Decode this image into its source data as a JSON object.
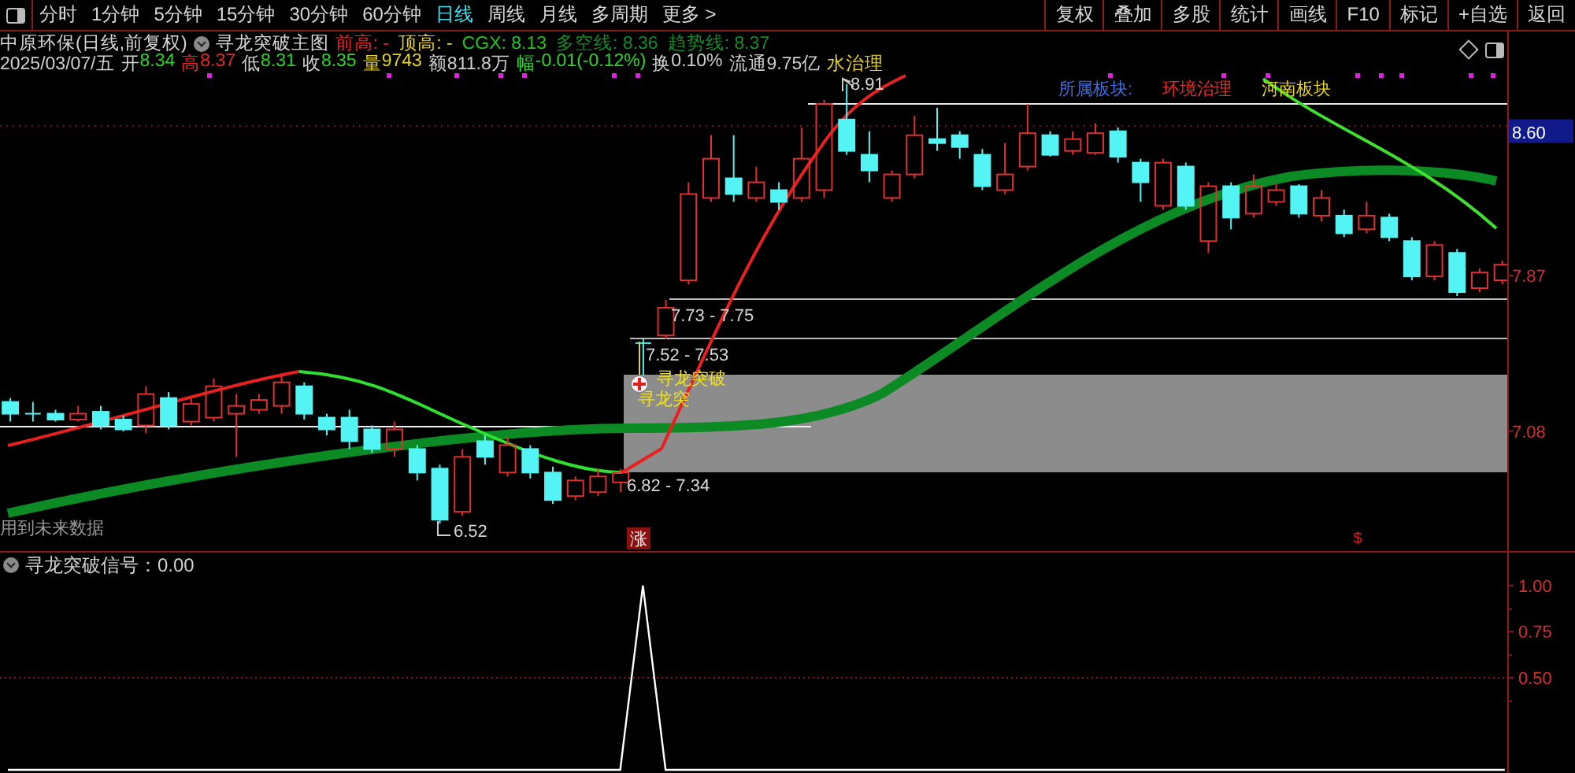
{
  "toolbar": {
    "periods": [
      {
        "label": "分时",
        "selected": false
      },
      {
        "label": "1分钟",
        "selected": false
      },
      {
        "label": "5分钟",
        "selected": false
      },
      {
        "label": "15分钟",
        "selected": false
      },
      {
        "label": "30分钟",
        "selected": false
      },
      {
        "label": "60分钟",
        "selected": false
      },
      {
        "label": "日线",
        "selected": true
      },
      {
        "label": "周线",
        "selected": false
      },
      {
        "label": "月线",
        "selected": false
      },
      {
        "label": "多周期",
        "selected": false
      },
      {
        "label": "更多 >",
        "selected": false
      }
    ],
    "buttons": [
      "复权",
      "叠加",
      "多股",
      "统计",
      "画线",
      "F10",
      "标记",
      "+自选",
      "返回"
    ]
  },
  "header": {
    "stock": "中原环保(日线,前复权)",
    "indicator": "寻龙突破主图",
    "fields": [
      {
        "text": "前高: -",
        "color": "#e8262a"
      },
      {
        "text": "顶高: -",
        "color": "#e6d220"
      },
      {
        "text": "CGX: 8.13",
        "color": "#22c322"
      },
      {
        "text": "多空线: 8.36",
        "color": "#138a2c"
      },
      {
        "text": "趋势线: 8.37",
        "color": "#138a2c"
      }
    ]
  },
  "quote": {
    "date": "2025/03/07/五",
    "fields": [
      {
        "parts": [
          {
            "text": "开",
            "color": "#d0d0d0"
          },
          {
            "text": "8.34",
            "color": "#2ed12e"
          }
        ]
      },
      {
        "parts": [
          {
            "text": "高",
            "color": "#e8262a"
          },
          {
            "text": "8.37",
            "color": "#e8262a"
          }
        ]
      },
      {
        "parts": [
          {
            "text": "低",
            "color": "#d0d0d0"
          },
          {
            "text": "8.31",
            "color": "#2ed12e"
          }
        ]
      },
      {
        "parts": [
          {
            "text": "收",
            "color": "#d0d0d0"
          },
          {
            "text": "8.35",
            "color": "#2ed12e"
          }
        ]
      },
      {
        "parts": [
          {
            "text": "量",
            "color": "#e6d220"
          },
          {
            "text": "9743",
            "color": "#e6d220"
          }
        ]
      },
      {
        "parts": [
          {
            "text": "额",
            "color": "#d0d0d0"
          },
          {
            "text": "811.8万",
            "color": "#d0d0d0"
          }
        ]
      },
      {
        "parts": [
          {
            "text": "幅",
            "color": "#2ed12e"
          },
          {
            "text": "-0.01(-0.12%)",
            "color": "#2ed12e"
          }
        ]
      },
      {
        "parts": [
          {
            "text": "换",
            "color": "#d0d0d0"
          },
          {
            "text": "0.10%",
            "color": "#d0d0d0"
          }
        ]
      },
      {
        "parts": [
          {
            "text": "流通",
            "color": "#d0d0d0"
          },
          {
            "text": "9.75亿",
            "color": "#d0d0d0"
          }
        ]
      },
      {
        "parts": [
          {
            "text": "水治理",
            "color": "#e6d220"
          }
        ]
      }
    ]
  },
  "chart": {
    "sector_label": "所属板块:",
    "sector": "环境治理",
    "region": "河南板块",
    "annotations": [
      "8.91",
      "7.73 - 7.75",
      "7.52 - 7.53",
      "6.82 - 7.34",
      "6.52"
    ],
    "signal_labels": [
      "寻龙突破",
      "寻龙突"
    ],
    "note": "用到未来数据",
    "markers": [
      {
        "text": "涨",
        "kind": "badge"
      },
      {
        "text": "$",
        "kind": "plain"
      }
    ],
    "price_ticks": [
      {
        "highlighted": true
      },
      {
        "highlighted": false
      },
      {
        "highlighted": false
      }
    ],
    "chart_data": {
      "type": "candlestick",
      "ylim": [
        6.47,
        9.11
      ],
      "yticks": [
        {
          "value": 8.6,
          "label": "8.60"
        },
        {
          "value": 7.87,
          "label": "7.87"
        },
        {
          "value": 7.08,
          "label": "7.08"
        }
      ],
      "ohlc": [
        [
          7.23,
          7.25,
          7.13,
          7.17
        ],
        [
          7.17,
          7.23,
          7.13,
          7.17
        ],
        [
          7.17,
          7.19,
          7.13,
          7.14
        ],
        [
          7.14,
          7.21,
          7.13,
          7.17
        ],
        [
          7.18,
          7.21,
          7.09,
          7.11
        ],
        [
          7.14,
          7.16,
          7.08,
          7.09
        ],
        [
          7.11,
          7.31,
          7.07,
          7.27
        ],
        [
          7.25,
          7.28,
          7.09,
          7.11
        ],
        [
          7.13,
          7.25,
          7.11,
          7.22
        ],
        [
          7.15,
          7.35,
          7.13,
          7.31
        ],
        [
          7.17,
          7.27,
          6.95,
          7.21
        ],
        [
          7.19,
          7.27,
          7.17,
          7.24
        ],
        [
          7.21,
          7.37,
          7.17,
          7.33
        ],
        [
          7.31,
          7.33,
          7.14,
          7.17
        ],
        [
          7.15,
          7.17,
          7.06,
          7.09
        ],
        [
          7.15,
          7.19,
          6.99,
          7.03
        ],
        [
          7.09,
          7.11,
          6.97,
          6.99
        ],
        [
          6.99,
          7.13,
          6.95,
          7.09
        ],
        [
          6.99,
          7.01,
          6.83,
          6.87
        ],
        [
          6.89,
          6.91,
          6.61,
          6.63
        ],
        [
          6.67,
          6.99,
          6.65,
          6.95
        ],
        [
          7.03,
          7.06,
          6.91,
          6.95
        ],
        [
          6.87,
          7.05,
          6.85,
          7.01
        ],
        [
          6.99,
          7.01,
          6.84,
          6.87
        ],
        [
          6.87,
          6.9,
          6.71,
          6.73
        ],
        [
          6.75,
          6.85,
          6.73,
          6.83
        ],
        [
          6.77,
          6.89,
          6.75,
          6.85
        ],
        [
          6.82,
          6.89,
          6.77,
          6.87
        ],
        [
          7.53,
          7.55,
          7.35,
          7.53
        ],
        [
          7.57,
          7.75,
          7.55,
          7.71
        ],
        [
          7.85,
          8.35,
          7.83,
          8.29
        ],
        [
          8.27,
          8.59,
          8.25,
          8.47
        ],
        [
          8.37,
          8.59,
          8.25,
          8.29
        ],
        [
          8.27,
          8.43,
          8.25,
          8.35
        ],
        [
          8.31,
          8.35,
          8.21,
          8.25
        ],
        [
          8.27,
          8.63,
          8.25,
          8.47
        ],
        [
          8.31,
          8.77,
          8.27,
          8.75
        ],
        [
          8.67,
          8.85,
          8.49,
          8.51
        ],
        [
          8.49,
          8.61,
          8.35,
          8.41
        ],
        [
          8.27,
          8.41,
          8.25,
          8.39
        ],
        [
          8.39,
          8.69,
          8.37,
          8.59
        ],
        [
          8.57,
          8.73,
          8.51,
          8.55
        ],
        [
          8.59,
          8.61,
          8.47,
          8.53
        ],
        [
          8.49,
          8.52,
          8.31,
          8.33
        ],
        [
          8.31,
          8.55,
          8.29,
          8.39
        ],
        [
          8.43,
          8.75,
          8.41,
          8.6
        ],
        [
          8.59,
          8.61,
          8.48,
          8.49
        ],
        [
          8.51,
          8.61,
          8.49,
          8.57
        ],
        [
          8.5,
          8.65,
          8.49,
          8.6
        ],
        [
          8.61,
          8.63,
          8.45,
          8.48
        ],
        [
          8.45,
          8.47,
          8.25,
          8.35
        ],
        [
          8.23,
          8.47,
          8.21,
          8.45
        ],
        [
          8.43,
          8.45,
          8.21,
          8.23
        ],
        [
          8.05,
          8.35,
          7.99,
          8.33
        ],
        [
          8.33,
          8.35,
          8.11,
          8.17
        ],
        [
          8.19,
          8.39,
          8.17,
          8.33
        ],
        [
          8.25,
          8.34,
          8.23,
          8.31
        ],
        [
          8.33,
          8.34,
          8.17,
          8.19
        ],
        [
          8.18,
          8.31,
          8.15,
          8.27
        ],
        [
          8.18,
          8.21,
          8.07,
          8.09
        ],
        [
          8.11,
          8.25,
          8.09,
          8.18
        ],
        [
          8.17,
          8.19,
          8.05,
          8.07
        ],
        [
          8.05,
          8.07,
          7.85,
          7.87
        ],
        [
          7.87,
          8.05,
          7.85,
          8.03
        ],
        [
          7.99,
          8.01,
          7.77,
          7.79
        ],
        [
          7.81,
          7.91,
          7.79,
          7.89
        ],
        [
          7.85,
          7.95,
          7.83,
          7.93
        ]
      ]
    }
  },
  "indicator": {
    "reading": "：0.00",
    "chart_data": {
      "type": "line",
      "ylim": [
        0,
        1.17
      ],
      "yticks": [
        {
          "value": 1,
          "label": "1.00"
        },
        {
          "value": 0.75,
          "label": "0.75"
        },
        {
          "value": 0.5,
          "label": "0.50"
        }
      ],
      "series": [
        {
          "name": "寻龙突破信号",
          "color": "#ffffff",
          "values": [
            0,
            0,
            0,
            0,
            0,
            0,
            0,
            0,
            0,
            0,
            0,
            0,
            0,
            0,
            0,
            0,
            0,
            0,
            0,
            0,
            0,
            0,
            0,
            0,
            0,
            0,
            0,
            0,
            1,
            0,
            0,
            0,
            0,
            0,
            0,
            0,
            0,
            0,
            0,
            0,
            0,
            0,
            0,
            0,
            0,
            0,
            0,
            0,
            0,
            0,
            0,
            0,
            0,
            0,
            0,
            0,
            0,
            0,
            0,
            0,
            0,
            0,
            0,
            0,
            0,
            0,
            0
          ]
        }
      ]
    }
  }
}
